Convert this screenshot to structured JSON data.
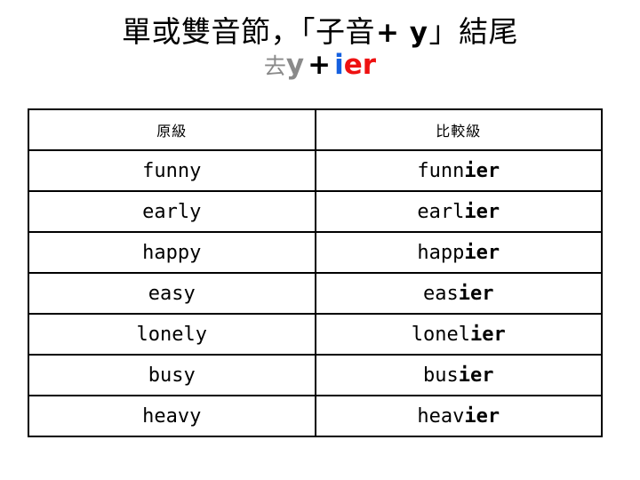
{
  "slide": {
    "background_color": "#ffffff"
  },
  "title": {
    "line1_prefix": "單或雙音節，「子音",
    "line1_plus_y": "+ y",
    "line1_suffix": "」結尾",
    "line2_drop_cjk": "去",
    "line2_drop_y": "y",
    "line2_plus": "+",
    "line2_suffix_i": "i",
    "line2_suffix_er": "er"
  },
  "colors": {
    "gray": "#8a8a8a",
    "black": "#000000",
    "blue": "#1560e0",
    "red": "#ee1111",
    "border": "#000000"
  },
  "table": {
    "headers": [
      "原級",
      "比較級"
    ],
    "rows": [
      {
        "positive": "funny",
        "comparative_stem": "funn",
        "comparative_suffix": "ier"
      },
      {
        "positive": "early",
        "comparative_stem": "earl",
        "comparative_suffix": "ier"
      },
      {
        "positive": "happy",
        "comparative_stem": "happ",
        "comparative_suffix": "ier"
      },
      {
        "positive": "easy",
        "comparative_stem": "eas",
        "comparative_suffix": "ier"
      },
      {
        "positive": "lonely",
        "comparative_stem": "lonel",
        "comparative_suffix": "ier"
      },
      {
        "positive": "busy",
        "comparative_stem": "bus",
        "comparative_suffix": "ier"
      },
      {
        "positive": "heavy",
        "comparative_stem": "heav",
        "comparative_suffix": "ier"
      }
    ]
  }
}
